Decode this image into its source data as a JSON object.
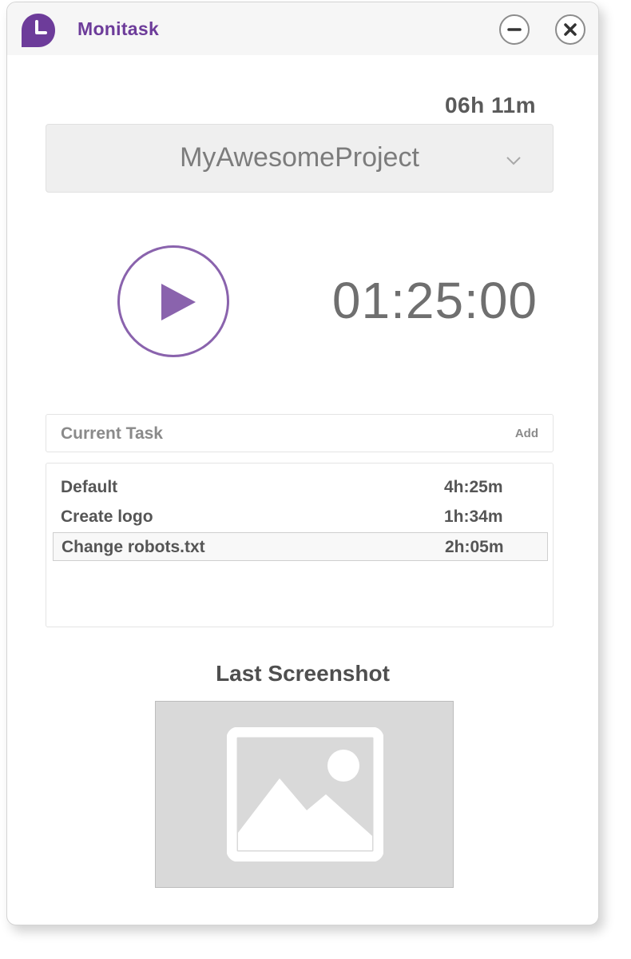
{
  "app": {
    "title": "Monitask",
    "brand_color": "#6d3c9a",
    "logo_icon": "clock-logo-icon"
  },
  "window_controls": {
    "minimize_icon": "minimize-icon",
    "close_icon": "close-icon"
  },
  "summary": {
    "total_time": "06h 11m"
  },
  "project": {
    "selected": "MyAwesomeProject",
    "dropdown_icon": "chevron-down-icon"
  },
  "tracker": {
    "play_icon": "play-icon",
    "accent_color": "#8a63ad",
    "timer": "01:25:00"
  },
  "tasks": {
    "header_label": "Current Task",
    "add_label": "Add",
    "items": [
      {
        "name": "Default",
        "time": "4h:25m",
        "selected": false
      },
      {
        "name": "Create logo",
        "time": "1h:34m",
        "selected": false
      },
      {
        "name": "Change robots.txt",
        "time": "2h:05m",
        "selected": true
      }
    ]
  },
  "screenshot": {
    "title": "Last Screenshot",
    "placeholder_icon": "image-placeholder-icon"
  }
}
